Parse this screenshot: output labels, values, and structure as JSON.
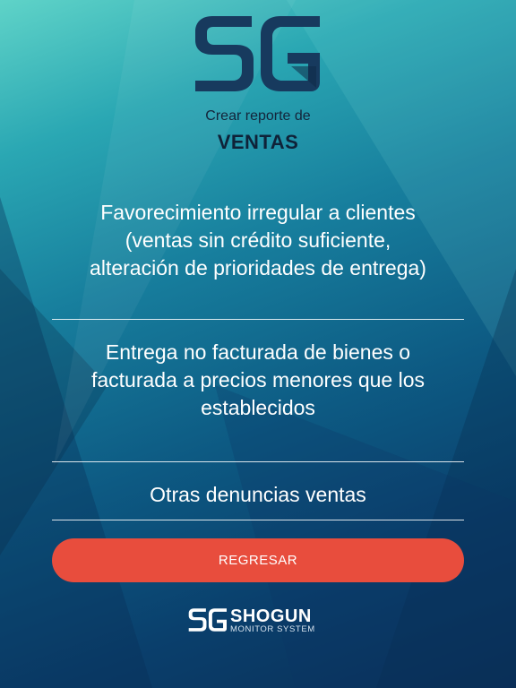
{
  "header": {
    "logo_text": "SG",
    "subtitle": "Crear reporte de",
    "title": "VENTAS"
  },
  "options": [
    {
      "label": "Favorecimiento irregular a clientes (ventas sin crédito suficiente, alteración de prioridades de entrega)"
    },
    {
      "label": "Entrega no facturada de bienes o facturada a precios menores que los establecidos"
    },
    {
      "label": "Otras denuncias ventas"
    }
  ],
  "back_button": {
    "label": "REGRESAR"
  },
  "footer": {
    "logo_text": "SG",
    "brand_name": "SHOGUN",
    "brand_tagline": "MONITOR SYSTEM"
  },
  "colors": {
    "primary_dark": "#173a5e",
    "accent_red": "#e84d3d",
    "text_light": "#ffffff"
  }
}
